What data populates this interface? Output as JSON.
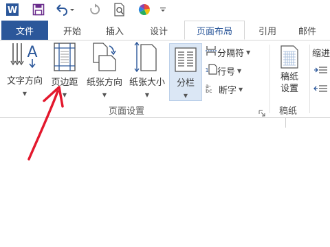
{
  "tabs": {
    "file": "文件",
    "home": "开始",
    "insert": "插入",
    "design": "设计",
    "layout": "页面布局",
    "references": "引用",
    "mailings": "邮件"
  },
  "ribbon": {
    "text_direction": "文字方向",
    "margins": "页边距",
    "orientation": "纸张方向",
    "size": "纸张大小",
    "columns": "分栏",
    "breaks": "分隔符",
    "line_numbers": "行号",
    "hyphenation": "断字",
    "draft_paper_line1": "稿纸",
    "draft_paper_line2": "设置",
    "indent": "缩进",
    "group_page_setup": "页面设置",
    "group_draft_paper": "稿纸"
  },
  "colors": {
    "accent": "#2b579a",
    "annotation_arrow": "#e3182d",
    "frame": "#d4142a"
  }
}
